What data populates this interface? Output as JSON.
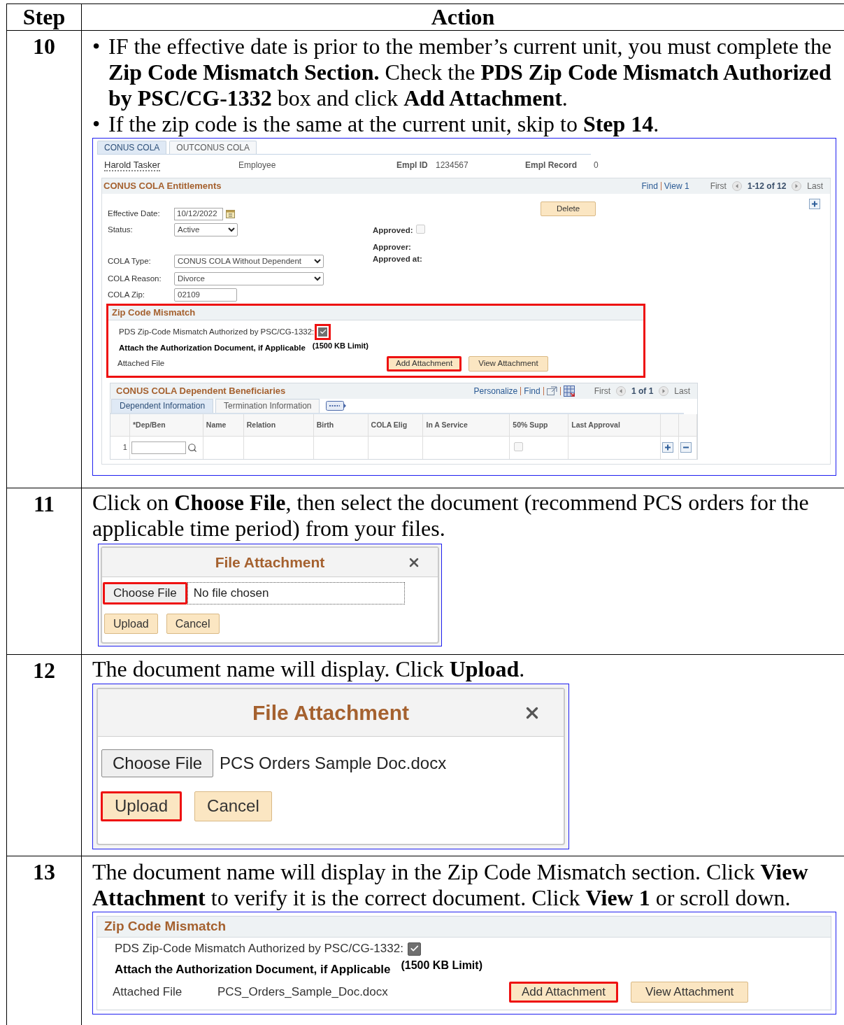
{
  "table": {
    "columns": [
      "Step",
      "Action"
    ]
  },
  "steps": [
    {
      "number": "10",
      "kind": "entitlements_page",
      "instructions": [
        {
          "bullet": "•",
          "text": "IF the effective date is prior to the member’s current unit, you must complete the **Zip Code Mismatch Section.** Check the **PDS Zip Code Mismatch Authorized by PSC/CG-1332** box and click **Add Attachment**."
        },
        {
          "bullet": "•",
          "text": "If the zip code is the same at the current unit, skip to **Step 14**."
        }
      ],
      "screen": {
        "tabs": [
          {
            "label": "CONUS COLA",
            "selected": true
          },
          {
            "label": "OUTCONUS COLA",
            "selected": false
          }
        ],
        "employee": {
          "name": "Harold Tasker",
          "role": "Employee",
          "id_label": "Empl ID",
          "id": "1234567",
          "record_label": "Empl Record",
          "record": "0"
        },
        "entitlements": {
          "title": "CONUS COLA Entitlements",
          "nav": {
            "find": "Find",
            "view": "View 1",
            "first": "First",
            "range": "1-12 of 12",
            "last": "Last"
          },
          "effective_date": {
            "label": "Effective Date:",
            "value": "10/12/2022"
          },
          "status": {
            "label": "Status:",
            "value": "Active"
          },
          "cola_type": {
            "label": "COLA Type:",
            "value": "CONUS COLA Without Dependent"
          },
          "cola_reason": {
            "label": "COLA Reason:",
            "value": "Divorce"
          },
          "cola_zip": {
            "label": "COLA Zip:",
            "value": "02109"
          },
          "delete": "Delete",
          "approved": {
            "label": "Approved:",
            "checked": false
          },
          "approver": "Approver:",
          "approved_at": "Approved at:"
        },
        "zip_mismatch": {
          "title": "Zip Code Mismatch",
          "highlighted": true,
          "authorized": {
            "label": "PDS Zip-Code Mismatch Authorized by PSC/CG-1332:",
            "checked": true,
            "highlighted": true
          },
          "attach_label": "Attach the Authorization Document, if Applicable",
          "limit": "(1500 KB Limit)",
          "attached_label": "Attached File",
          "buttons": [
            {
              "label": "Add Attachment",
              "highlighted": true
            },
            {
              "label": "View Attachment",
              "highlighted": false
            }
          ]
        },
        "dependents": {
          "title": "CONUS COLA Dependent Beneficiaries",
          "links": [
            "Personalize",
            "Find"
          ],
          "nav": {
            "first": "First",
            "range": "1 of 1",
            "last": "Last"
          },
          "tabs": [
            {
              "label": "Dependent Information",
              "selected": true
            },
            {
              "label": "Termination Information",
              "selected": false
            }
          ],
          "columns": [
            "*Dep/Ben",
            "Name",
            "Relation",
            "Birth",
            "COLA Elig",
            "In A Service",
            "50% Supp",
            "Last Approval"
          ],
          "rows": [
            {
              "number": "1",
              "supp_checked": false
            }
          ]
        }
      }
    },
    {
      "number": "11",
      "kind": "file_dialog",
      "text": "Click on **Choose File**, then select the document (recommend PCS orders for the applicable time period) from your files.",
      "dialog": {
        "title": "File Attachment",
        "choose": {
          "label": "Choose File",
          "highlighted": true
        },
        "file_status": "No file chosen",
        "buttons": [
          {
            "label": "Upload",
            "highlighted": false
          },
          {
            "label": "Cancel",
            "highlighted": false
          }
        ]
      }
    },
    {
      "number": "12",
      "kind": "file_dialog_zoomed",
      "text": "The document name will display. Click **Upload**.",
      "dialog": {
        "title": "File Attachment",
        "choose": {
          "label": "Choose File",
          "highlighted": false
        },
        "file_status": "PCS Orders Sample Doc.docx",
        "buttons": [
          {
            "label": "Upload",
            "highlighted": true
          },
          {
            "label": "Cancel",
            "highlighted": false
          }
        ]
      }
    },
    {
      "number": "13",
      "kind": "zip_section",
      "text": "The document name will display in the Zip Code Mismatch section. Click **View Attachment** to verify it is the correct document. Click **View 1** or scroll down.",
      "zip_mismatch": {
        "title": "Zip Code Mismatch",
        "highlighted": false,
        "authorized": {
          "label": "PDS Zip-Code Mismatch Authorized by PSC/CG-1332:",
          "checked": true
        },
        "attach_label": "Attach the Authorization Document, if Applicable",
        "limit": "(1500 KB Limit)",
        "attached_label": "Attached File",
        "file": "PCS_Orders_Sample_Doc.docx",
        "buttons": [
          {
            "label": "Add Attachment",
            "highlighted": true
          },
          {
            "label": "View Attachment",
            "highlighted": false
          }
        ]
      }
    }
  ]
}
